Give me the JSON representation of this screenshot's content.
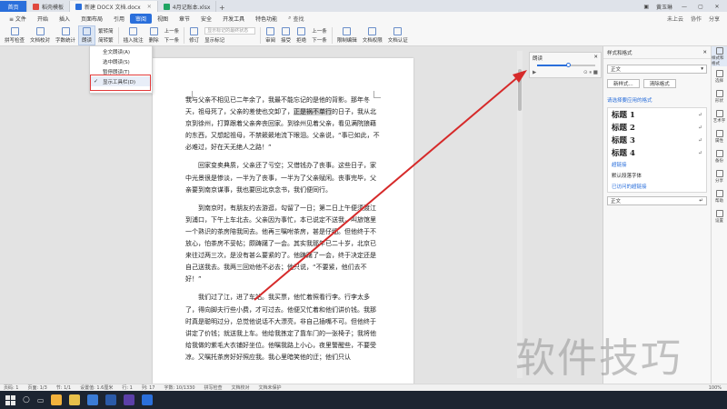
{
  "tabs": {
    "home": "首页",
    "items": [
      {
        "label": "稻壳模板",
        "color": "#e0483e"
      },
      {
        "label": "新建 DOCX 文档.docx",
        "color": "#2a6fdb"
      },
      {
        "label": "4月记账本.xlsx",
        "color": "#1fa463"
      }
    ],
    "user": "黄玉琳",
    "add": "+"
  },
  "menu": {
    "file": "≡ 文件",
    "items": [
      "开始",
      "插入",
      "页面布局",
      "引用",
      "审阅",
      "视图",
      "章节",
      "安全",
      "开发工具",
      "特色功能"
    ],
    "active": "审阅",
    "search": "查找",
    "right": [
      "未上云",
      "协作",
      "分享"
    ]
  },
  "ribbon": {
    "spellcheck": "拼写检查",
    "doc_proof": "文档校对",
    "word_count": "字数统计",
    "read_aloud": "朗读",
    "trans_convert": "繁转简",
    "simp_convert": "简转繁",
    "insert_comment": "插入批注",
    "delete": "删除",
    "prev_comment": "上一条",
    "next_comment": "下一条",
    "revise": "修订",
    "markup_select": "显示标记的最终状态",
    "show_markup": "显示标记",
    "review": "审阅",
    "accept": "接受",
    "reject": "拒绝",
    "prev_change": "上一条",
    "next_change": "下一条",
    "limit_edit": "限制编辑",
    "doc_perm": "文档权限",
    "doc_auth": "文档认证"
  },
  "dropdown": {
    "items": [
      {
        "label": "全文朗读(A)"
      },
      {
        "label": "选中朗读(S)"
      },
      {
        "label": "暂停朗读(T)"
      },
      {
        "label": "显示工具栏(D)"
      }
    ],
    "check": "✓"
  },
  "reading_tool": {
    "label": "朗读",
    "volume": 0.55
  },
  "document": {
    "paragraphs": [
      "我与父亲不相见已二年余了，我最不能忘记的是他的背影。那年冬天，祖母死了，父亲的差使也交卸了，正是祸不单行的日子，我从北京到徐州，打算跟着父亲奔丧回家。到徐州见着父亲，看见满院狼藉的东西，又想起祖母，不禁簌簌地流下眼泪。父亲说，“事已如此，不必难过，好在天无绝人之路！”",
      "回家变卖典质，父亲还了亏空；又借钱办了丧事。这些日子，家中光景很是惨淡，一半为了丧事，一半为了父亲赋闲。丧事完毕，父亲要到南京谋事，我也要回北京念书，我们便同行。",
      "到南京时，有朋友约去游逛，勾留了一日；第二日上午便须渡江到浦口，下午上车北去。父亲因为事忙，本已说定不送我，叫旅馆里一个熟识的茶房陪我同去。他再三嘱咐茶房，甚是仔细。但他终于不放心，怕茶房不妥帖；颇踌躇了一会。其实我那年已二十岁，北京已来往过两三次，是没有甚么要紧的了。他踌躇了一会，终于决定还是自己送我去。我两三回劝他不必去；他只说，“不要紧，他们去不好！”",
      "我们过了江，进了车站。我买票，他忙着照看行李。行李太多了，得向脚夫行些小费，才可过去。他便又忙着和他们讲价钱。我那时真是聪明过分，总觉他说话不大漂亮，非自己插嘴不可。但他终于讲定了价钱；就送我上车。他给我拣定了靠车门的一张椅子；我将他给我做的紫毛大衣铺好坐位。他嘱我路上小心，夜里警醒些，不要受凉。又嘱托茶房好好照应我。我心里暗笑他的迂；他们只认"
    ],
    "highlight": "正是祸不单行"
  },
  "style_pane": {
    "title": "样式和格式",
    "current": "正文",
    "new_style": "新样式...",
    "clear_format": "清除格式",
    "apply_hint": "请选择要应用的格式",
    "styles": [
      {
        "label": "标题 1",
        "kind": "h"
      },
      {
        "label": "标题 2",
        "kind": "h"
      },
      {
        "label": "标题 3",
        "kind": "h"
      },
      {
        "label": "标题 4",
        "kind": "h"
      },
      {
        "label": "超链接",
        "kind": "link"
      },
      {
        "label": "默认段落字体",
        "kind": "small"
      },
      {
        "label": "已访问的超链接",
        "kind": "link"
      },
      {
        "label": "正文",
        "kind": "small"
      }
    ],
    "return_mark": "↵"
  },
  "right_sidebar": {
    "items": [
      "样式和格式",
      "选择",
      "形状",
      "艺术字",
      "属性",
      "备份",
      "分享",
      "帮助",
      "设置"
    ]
  },
  "statusbar": {
    "page": "页码: 1",
    "pages": "页面: 1/3",
    "section": "节: 1/1",
    "setting": "设置值: 1.6厘米",
    "row": "行: 1",
    "col": "列: 17",
    "words": "字数: 10/1330",
    "spell": "拼写检查",
    "proof": "文档校对",
    "protect": "文档未保护",
    "zoom": "100%"
  },
  "watermark": "软件技巧",
  "colors": {
    "accent": "#2a6fdb",
    "highlight_box": "#e23b3b",
    "arrow": "#d62a2a"
  }
}
